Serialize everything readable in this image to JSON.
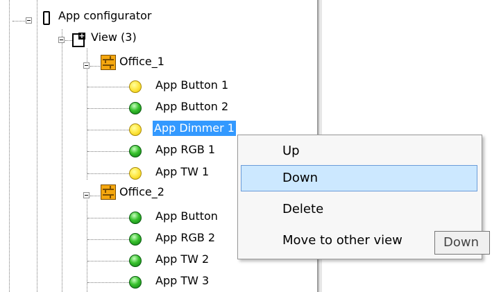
{
  "tree": {
    "root": {
      "label": "App configurator",
      "icon": "phone-icon"
    },
    "view": {
      "label": "View (3)",
      "icon": "view-add-icon"
    },
    "groups": [
      {
        "label": "Office_1",
        "icon": "room-icon",
        "items": [
          {
            "label": "App Button 1",
            "status": "yellow",
            "selected": false
          },
          {
            "label": "App Button 2",
            "status": "green",
            "selected": false
          },
          {
            "label": "App Dimmer 1",
            "status": "yellow",
            "selected": true
          },
          {
            "label": "App RGB 1",
            "status": "green",
            "selected": false
          },
          {
            "label": "App TW 1",
            "status": "yellow",
            "selected": false
          }
        ]
      },
      {
        "label": "Office_2",
        "icon": "room-icon",
        "items": [
          {
            "label": "App Button",
            "status": "green",
            "selected": false
          },
          {
            "label": "App RGB 2",
            "status": "green",
            "selected": false
          },
          {
            "label": "App TW 2",
            "status": "green",
            "selected": false
          },
          {
            "label": "App TW 3",
            "status": "green",
            "selected": false
          }
        ]
      }
    ]
  },
  "context_menu": {
    "items": [
      {
        "label": "Up",
        "highlighted": false
      },
      {
        "label": "Down",
        "highlighted": true
      },
      {
        "label": "Delete",
        "highlighted": false
      },
      {
        "label": "Move to other view",
        "highlighted": false
      }
    ]
  },
  "tooltip": {
    "text": "Down"
  },
  "colors": {
    "selection": "#3399ff",
    "menu_highlight": "#cce8ff",
    "status_yellow": "#ffe94a",
    "status_green": "#39c22e",
    "room_icon": "#f5a70f"
  }
}
